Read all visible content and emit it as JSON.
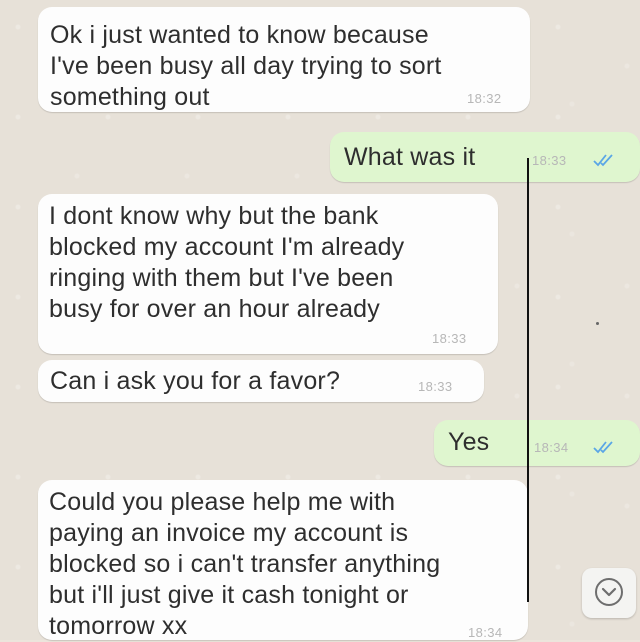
{
  "chat": {
    "messages": [
      {
        "direction": "incoming",
        "text": "Ok i just wanted to know because\nI've been busy all day trying to sort\nsomething out",
        "time": "18:32"
      },
      {
        "direction": "outgoing",
        "text": "What was it",
        "time": "18:33",
        "read_ticks": "double-check-icon"
      },
      {
        "direction": "incoming",
        "text": "I dont know why but the bank\nblocked my account I'm already\nringing with them but I've been\nbusy for over an hour already",
        "time": "18:33"
      },
      {
        "direction": "incoming",
        "text": "Can i ask you for a favor?",
        "time": "18:33"
      },
      {
        "direction": "outgoing",
        "text": "Yes",
        "time": "18:34",
        "read_ticks": "double-check-icon"
      },
      {
        "direction": "incoming",
        "text": "Could you please help me with\npaying an invoice my account is\nblocked so i can't transfer anything\nbut i'll just give it cash tonight or\ntomorrow xx",
        "time": "18:34"
      }
    ]
  },
  "controls": {
    "scroll_down_icon": "chevron-down-circle-icon"
  },
  "colors": {
    "incoming_bubble": "#fdfdfd",
    "outgoing_bubble": "#dff6cf",
    "read_ticks": "#5aa6e6",
    "wallpaper": "#e7e1d8"
  }
}
